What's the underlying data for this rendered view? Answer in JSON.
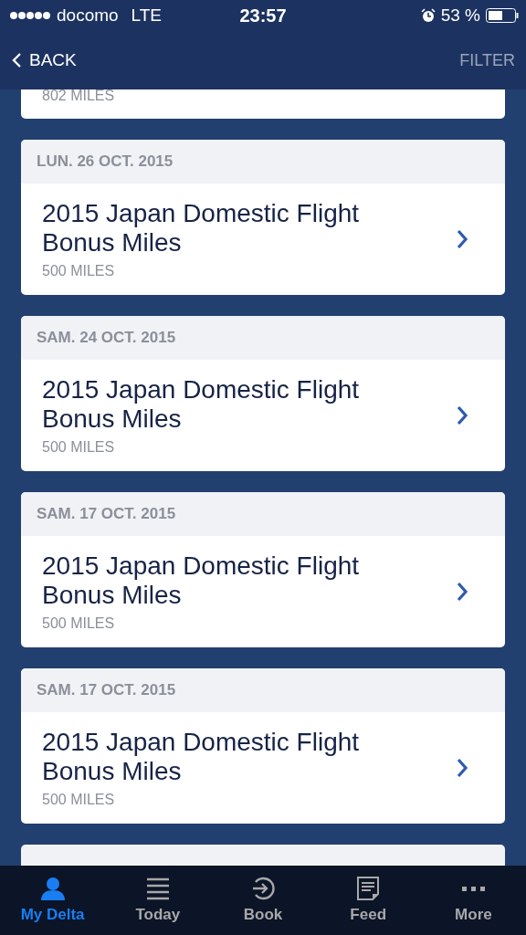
{
  "status_bar": {
    "carrier": "docomo",
    "network": "LTE",
    "time": "23:57",
    "battery_percent": "53 %"
  },
  "nav": {
    "back": "BACK",
    "filter": "FILTER"
  },
  "partial_top": {
    "miles": "802 MILES"
  },
  "transactions": [
    {
      "date": "LUN. 26 OCT. 2015",
      "title": "2015 Japan Domestic Flight Bonus Miles",
      "miles": "500 MILES"
    },
    {
      "date": "SAM. 24 OCT. 2015",
      "title": "2015 Japan Domestic Flight Bonus Miles",
      "miles": "500 MILES"
    },
    {
      "date": "SAM. 17 OCT. 2015",
      "title": "2015 Japan Domestic Flight Bonus Miles",
      "miles": "500 MILES"
    },
    {
      "date": "SAM. 17 OCT. 2015",
      "title": "2015 Japan Domestic Flight Bonus Miles",
      "miles": "500 MILES"
    }
  ],
  "tabs": [
    {
      "kind": "person",
      "label": "My Delta",
      "selected": true
    },
    {
      "kind": "list",
      "label": "Today",
      "selected": false
    },
    {
      "kind": "book",
      "label": "Book",
      "selected": false
    },
    {
      "kind": "feed",
      "label": "Feed",
      "selected": false
    },
    {
      "kind": "more",
      "label": "More",
      "selected": false
    }
  ]
}
